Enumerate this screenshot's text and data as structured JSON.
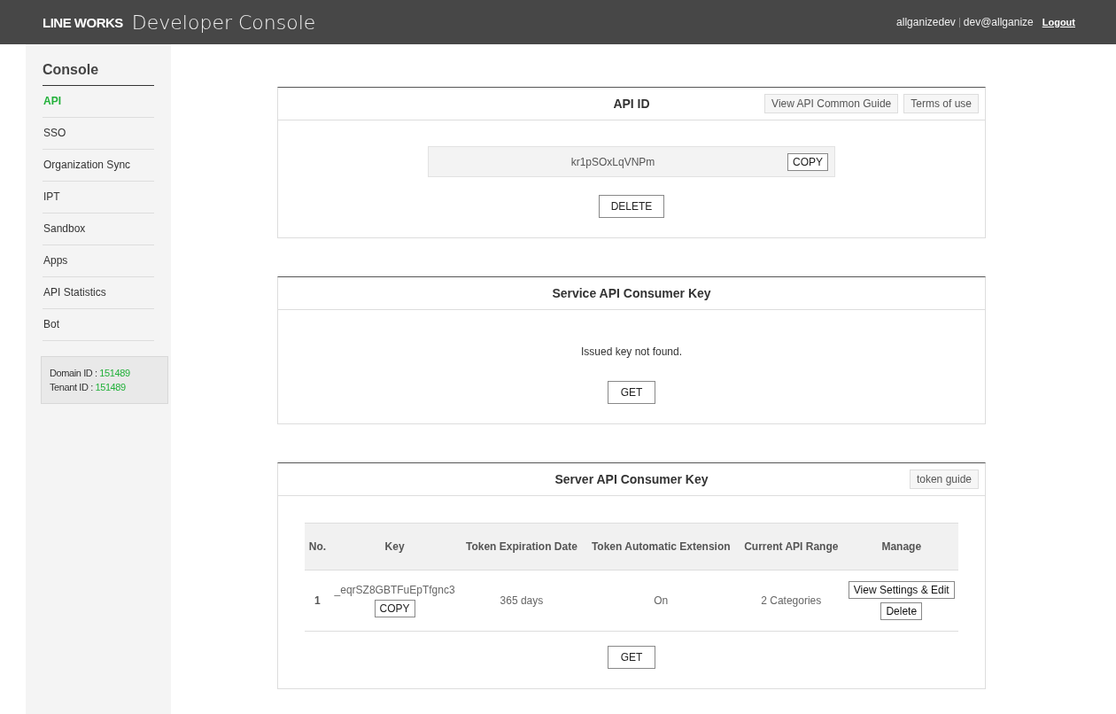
{
  "header": {
    "logo": "LINE WORKS",
    "title": "Developer Console",
    "user": "allganizedev",
    "email": "dev@allganize",
    "logout": "Logout"
  },
  "sidebar": {
    "title": "Console",
    "items": [
      {
        "label": "API",
        "selected": true
      },
      {
        "label": "SSO",
        "selected": false
      },
      {
        "label": "Organization Sync",
        "selected": false
      },
      {
        "label": "IPT",
        "selected": false
      },
      {
        "label": "Sandbox",
        "selected": false
      },
      {
        "label": "Apps",
        "selected": false
      },
      {
        "label": "API Statistics",
        "selected": false
      },
      {
        "label": "Bot",
        "selected": false
      }
    ],
    "info": [
      {
        "label": "Domain ID :",
        "value": "151489"
      },
      {
        "label": "Tenant ID :",
        "value": "151489"
      }
    ]
  },
  "api_id": {
    "title": "API ID",
    "links": [
      "View API Common Guide",
      "Terms of use"
    ],
    "key": "kr1pSOxLqVNPm",
    "copy": "COPY",
    "delete": "DELETE"
  },
  "service_key": {
    "title": "Service API Consumer Key",
    "message": "Issued key not found.",
    "get": "GET"
  },
  "server_key": {
    "title": "Server API Consumer Key",
    "links": [
      "token guide"
    ],
    "columns": [
      "No.",
      "Key",
      "Token Expiration Date",
      "Token Automatic Extension",
      "Current API Range",
      "Manage"
    ],
    "rows": [
      {
        "no": "1",
        "key": "_eqrSZ8GBTFuEpTfgnc3",
        "copy": "COPY",
        "expiration": "365 days",
        "extension": "On",
        "range": "2 Categories",
        "edit": "View Settings & Edit",
        "delete": "Delete"
      }
    ],
    "get": "GET"
  }
}
